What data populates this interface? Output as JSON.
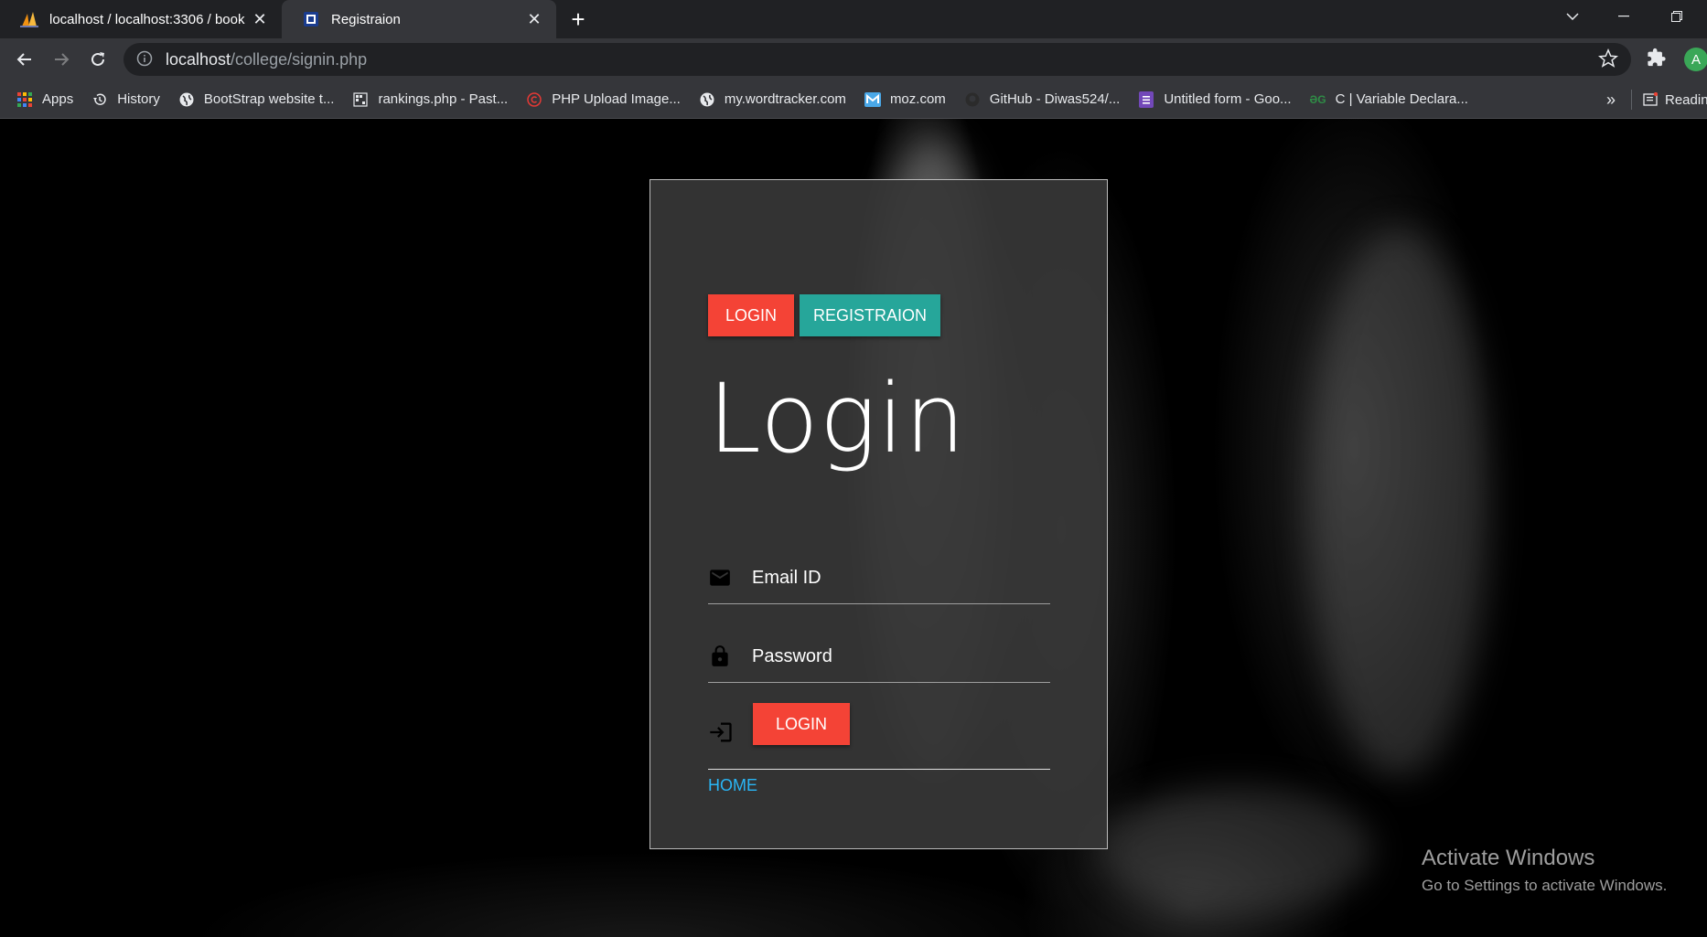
{
  "browser": {
    "tabs": [
      {
        "title": "localhost / localhost:3306 / book",
        "active": false
      },
      {
        "title": "Registraion",
        "active": true
      }
    ],
    "new_tab_label": "+",
    "address": {
      "host": "localhost",
      "path": "/college/signin.php"
    },
    "profile_initial": "A",
    "bookmarks": [
      {
        "label": "Apps",
        "icon": "apps-grid-icon"
      },
      {
        "label": "History",
        "icon": "history-icon"
      },
      {
        "label": "BootStrap website t...",
        "icon": "globe-icon"
      },
      {
        "label": "rankings.php - Past...",
        "icon": "pastebin-icon"
      },
      {
        "label": "PHP Upload Image...",
        "icon": "copyright-icon"
      },
      {
        "label": "my.wordtracker.com",
        "icon": "globe-icon"
      },
      {
        "label": "moz.com",
        "icon": "moz-icon"
      },
      {
        "label": "GitHub - Diwas524/...",
        "icon": "github-icon"
      },
      {
        "label": "Untitled form - Goo...",
        "icon": "forms-icon"
      },
      {
        "label": "C | Variable Declara...",
        "icon": "gfg-icon"
      }
    ],
    "bookmarks_overflow": "»",
    "reading_list_label": "Readin"
  },
  "page": {
    "tab_login": "LOGIN",
    "tab_register": "REGISTRAION",
    "heading": "Login",
    "email_label": "Email ID",
    "password_label": "Password",
    "submit_label": "LOGIN",
    "home_link": "HOME"
  },
  "watermark": {
    "title": "Activate Windows",
    "subtitle": "Go to Settings to activate Windows."
  },
  "colors": {
    "red": "#f44336",
    "teal": "#26a69a",
    "link": "#29b6f6",
    "card": "#373737"
  }
}
